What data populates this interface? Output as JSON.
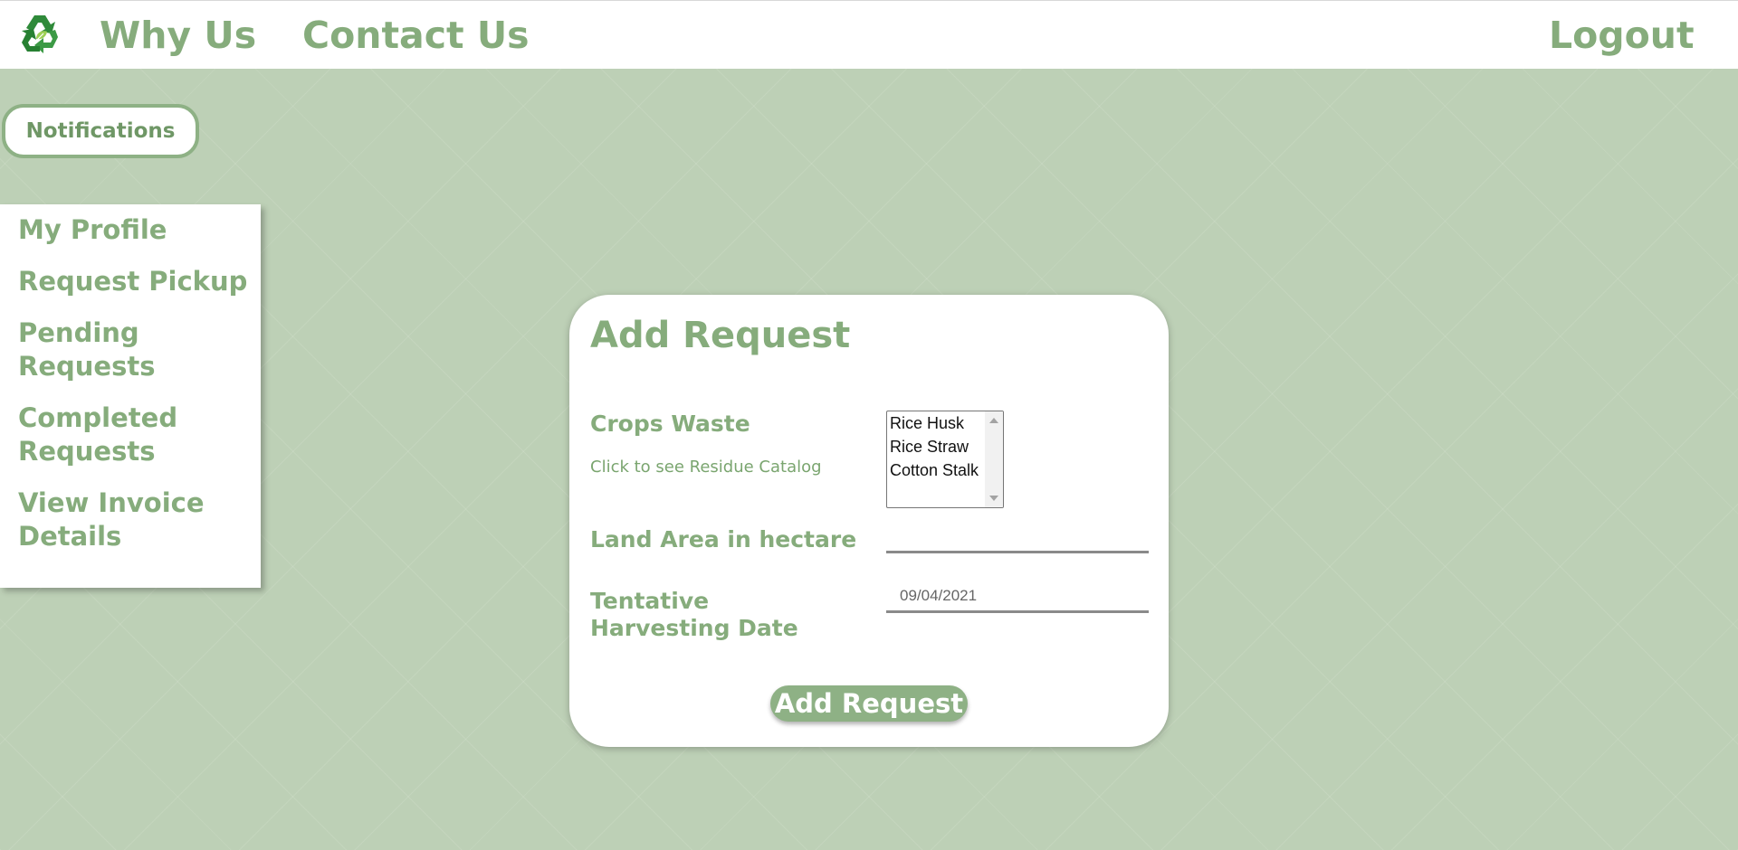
{
  "header": {
    "logo_icon": "recycle-icon",
    "nav": {
      "why_us": "Why Us",
      "contact_us": "Contact Us",
      "logout": "Logout"
    }
  },
  "notifications_label": "Notifications",
  "sidebar": {
    "items": [
      {
        "label": "My Profile"
      },
      {
        "label": "Request Pickup"
      },
      {
        "label": "Pending Requests"
      },
      {
        "label": "Completed Requests"
      },
      {
        "label": "View Invoice Details"
      }
    ]
  },
  "form": {
    "title": "Add Request",
    "crops_waste_label": "Crops Waste",
    "catalog_link": "Click to see Residue Catalog",
    "crops_options": [
      "Rice Husk",
      "Rice Straw",
      "Cotton Stalk"
    ],
    "land_area_label": "Land Area in hectare",
    "land_area_value": "",
    "harvest_date_label": "Tentative Harvesting Date",
    "harvest_date_value": "09/04/2021",
    "submit_label": "Add Request"
  },
  "colors": {
    "accent": "#86ac7c",
    "background": "#bdd0b6",
    "button": "#8eb185"
  }
}
